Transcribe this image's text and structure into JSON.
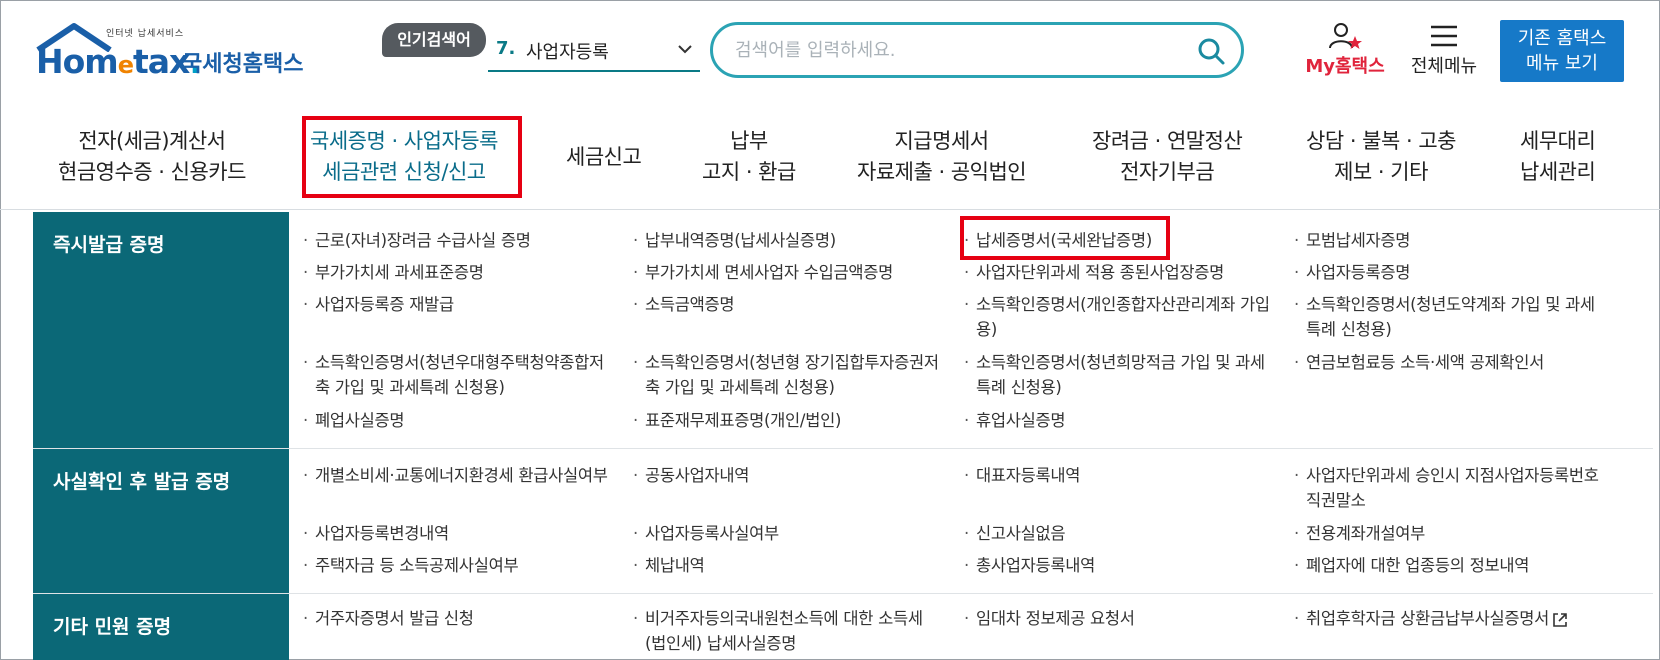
{
  "brand": {
    "sub_text": "인터넷 납세서비스",
    "logo_word_1": "Hom",
    "logo_word_2": "e",
    "logo_word_3": "tax",
    "logo_word_4": ".",
    "korean_name": "국세청홈택스"
  },
  "header": {
    "hot_search_label": "인기검색어",
    "hot_search_rank": "7.",
    "hot_search_term": "사업자등록",
    "search_placeholder": "검색어를 입력하세요.",
    "my_hometax": "My홈택스",
    "all_menu": "전체메뉴",
    "old_home_line1": "기존 홈택스",
    "old_home_line2": "메뉴 보기"
  },
  "nav": [
    {
      "line1": "전자(세금)계산서",
      "line2": "현금영수증 · 신용카드"
    },
    {
      "line1": "국세증명 · 사업자등록",
      "line2": "세금관련 신청/신고"
    },
    {
      "line1": "세금신고",
      "line2": ""
    },
    {
      "line1": "납부",
      "line2": "고지 · 환급"
    },
    {
      "line1": "지급명세서",
      "line2": "자료제출 · 공익법인"
    },
    {
      "line1": "장려금 · 연말정산",
      "line2": "전자기부금"
    },
    {
      "line1": "상담 · 불복 · 고충",
      "line2": "제보 · 기타"
    },
    {
      "line1": "세무대리",
      "line2": "납세관리"
    }
  ],
  "sections": [
    {
      "title": "즉시발급 증명",
      "links": [
        "근로(자녀)장려금 수급사실 증명",
        "납부내역증명(납세사실증명)",
        "납세증명서(국세완납증명)",
        "모범납세자증명",
        "부가가치세 과세표준증명",
        "부가가치세 면세사업자 수입금액증명",
        "사업자단위과세 적용 종된사업장증명",
        "사업자등록증명",
        "사업자등록증 재발급",
        "소득금액증명",
        "소득확인증명서(개인종합자산관리계좌 가입용)",
        "소득확인증명서(청년도약계좌 가입 및 과세특례 신청용)",
        "소득확인증명서(청년우대형주택청약종합저축 가입 및 과세특례 신청용)",
        "소득확인증명서(청년형 장기집합투자증권저축 가입 및 과세특례 신청용)",
        "소득확인증명서(청년희망적금 가입 및 과세특례 신청용)",
        "연금보험료등 소득·세액 공제확인서",
        "폐업사실증명",
        "표준재무제표증명(개인/법인)",
        "휴업사실증명"
      ]
    },
    {
      "title": "사실확인 후 발급 증명",
      "links": [
        "개별소비세·교통에너지환경세 환급사실여부",
        "공동사업자내역",
        "대표자등록내역",
        "사업자단위과세 승인시 지점사업자등록번호 직권말소",
        "사업자등록변경내역",
        "사업자등록사실여부",
        "신고사실없음",
        "전용계좌개설여부",
        "주택자금 등 소득공제사실여부",
        "체납내역",
        "총사업자등록내역",
        "폐업자에 대한 업종등의 정보내역"
      ]
    },
    {
      "title": "기타 민원 증명",
      "links": [
        "거주자증명서 발급 신청",
        "비거주자등의국내원천소득에 대한 소득세(법인세) 납세사실증명",
        "임대차 정보제공 요청서",
        "취업후학자금 상환금납부사실증명서"
      ]
    }
  ],
  "colors": {
    "category_bg": "#0b6877",
    "highlight": "#e60012",
    "search_border": "#2ba3b4",
    "brand_blue": "#1a5fa8",
    "old_home_bg": "#1679c8"
  }
}
